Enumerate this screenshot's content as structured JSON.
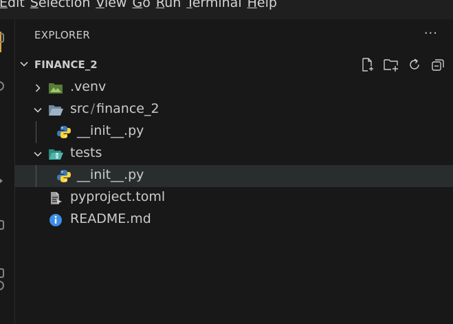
{
  "menu": {
    "items": [
      {
        "mnemonic": "E",
        "rest": "dit"
      },
      {
        "mnemonic": "S",
        "rest": "election"
      },
      {
        "mnemonic": "V",
        "rest": "iew"
      },
      {
        "mnemonic": "G",
        "rest": "o"
      },
      {
        "mnemonic": "R",
        "rest": "un"
      },
      {
        "mnemonic": "T",
        "rest": "erminal"
      },
      {
        "mnemonic": "H",
        "rest": "elp"
      }
    ]
  },
  "explorer": {
    "header": "EXPLORER",
    "more_actions": "···",
    "workspace": "FINANCE_2",
    "actions": [
      "new-file-icon",
      "new-folder-icon",
      "refresh-icon",
      "collapse-all-icon"
    ]
  },
  "tree": {
    "venv": {
      "label": ".venv",
      "icon": "folder-env-icon",
      "expanded": false
    },
    "src": {
      "label_a": "src",
      "sep": "/",
      "label_b": "finance_2",
      "icon": "folder-open-icon",
      "expanded": true
    },
    "src_init": {
      "label": "__init__.py",
      "icon": "python-icon"
    },
    "tests": {
      "label": "tests",
      "icon": "folder-tests-icon",
      "expanded": true
    },
    "tests_init": {
      "label": "__init__.py",
      "icon": "python-icon",
      "selected": true
    },
    "pyproject": {
      "label": "pyproject.toml",
      "icon": "toml-file-icon"
    },
    "readme": {
      "label": "README.md",
      "icon": "info-icon"
    }
  },
  "colors": {
    "background": "#181818",
    "selection": "#2a2d2e",
    "folder": "#8fa3b5",
    "env_folder": "#7cb342",
    "tests_folder": "#4db6ac",
    "python_blue": "#3572a5",
    "python_yellow": "#ffd43b",
    "info_blue": "#3d8ee6"
  }
}
